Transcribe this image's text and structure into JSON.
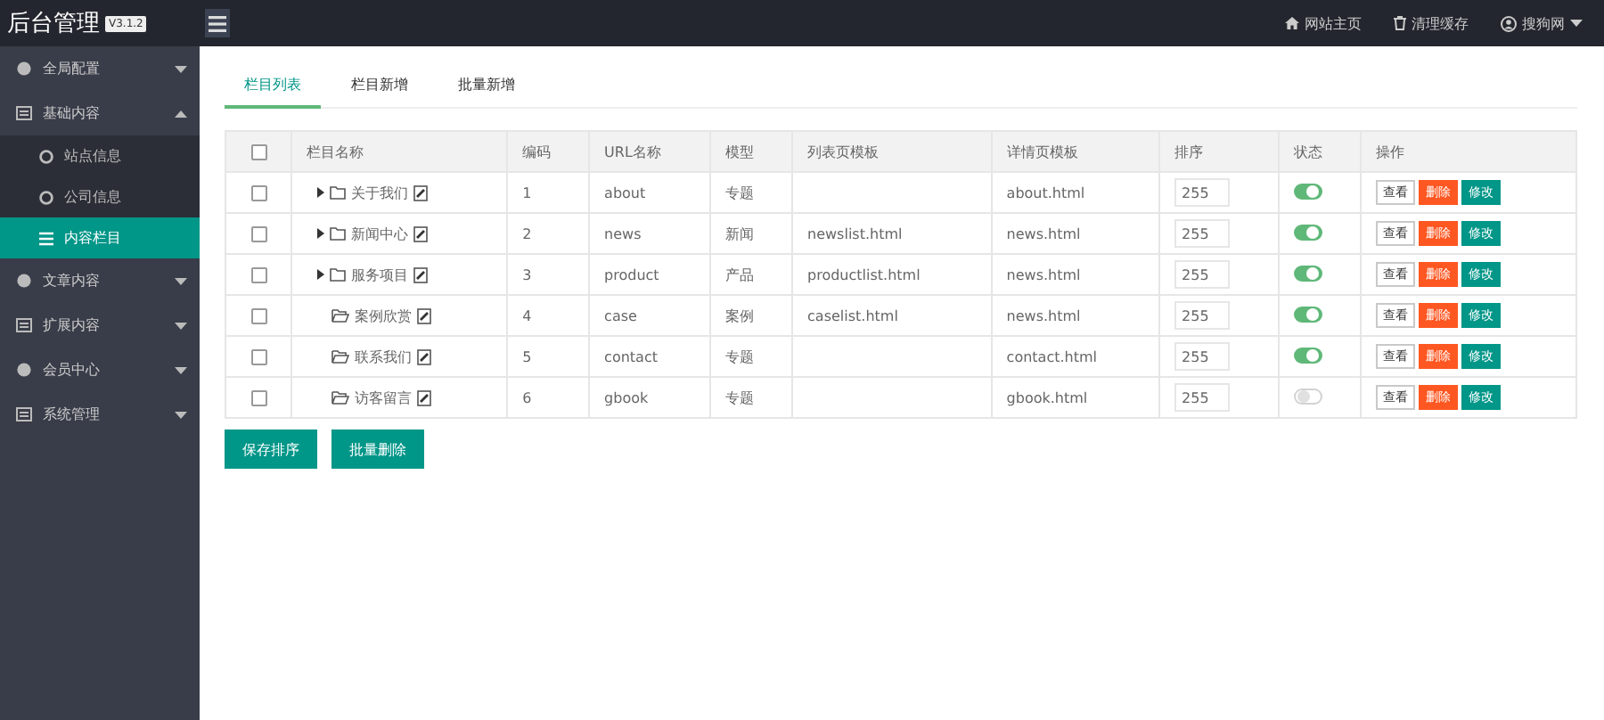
{
  "brand": {
    "title": "后台管理",
    "version": "V3.1.2"
  },
  "topbar": {
    "links": [
      {
        "label": "网站主页",
        "kind": "home"
      },
      {
        "label": "清理缓存",
        "kind": "trash"
      },
      {
        "label": "搜狗网",
        "kind": "user"
      }
    ]
  },
  "sidebar": {
    "items": [
      {
        "label": "全局配置",
        "expanded": false
      },
      {
        "label": "基础内容",
        "expanded": true,
        "children": [
          {
            "label": "站点信息",
            "selected": false
          },
          {
            "label": "公司信息",
            "selected": false
          },
          {
            "label": "内容栏目",
            "selected": true
          }
        ]
      },
      {
        "label": "文章内容",
        "expanded": false
      },
      {
        "label": "扩展内容",
        "expanded": false
      },
      {
        "label": "会员中心",
        "expanded": false
      },
      {
        "label": "系统管理",
        "expanded": false
      }
    ]
  },
  "tabs": [
    {
      "label": "栏目列表",
      "selected": true
    },
    {
      "label": "栏目新增",
      "selected": false
    },
    {
      "label": "批量新增",
      "selected": false
    }
  ],
  "table": {
    "select_all_checked": false,
    "columns": [
      "栏目名称",
      "编码",
      "URL名称",
      "模型",
      "列表页模板",
      "详情页模板",
      "排序",
      "状态",
      "操作"
    ],
    "rows": [
      {
        "checked": false,
        "has_children": true,
        "name": "关于我们",
        "code": "1",
        "url": "about",
        "model": "专题",
        "list_tpl": "",
        "detail_tpl": "about.html",
        "sort": "255",
        "on": true,
        "actions": [
          "查看",
          "删除",
          "修改"
        ]
      },
      {
        "checked": false,
        "has_children": true,
        "name": "新闻中心",
        "code": "2",
        "url": "news",
        "model": "新闻",
        "list_tpl": "newslist.html",
        "detail_tpl": "news.html",
        "sort": "255",
        "on": true,
        "actions": [
          "查看",
          "删除",
          "修改"
        ]
      },
      {
        "checked": false,
        "has_children": true,
        "name": "服务项目",
        "code": "3",
        "url": "product",
        "model": "产品",
        "list_tpl": "productlist.html",
        "detail_tpl": "news.html",
        "sort": "255",
        "on": true,
        "actions": [
          "查看",
          "删除",
          "修改"
        ]
      },
      {
        "checked": false,
        "has_children": false,
        "name": "案例欣赏",
        "code": "4",
        "url": "case",
        "model": "案例",
        "list_tpl": "caselist.html",
        "detail_tpl": "news.html",
        "sort": "255",
        "on": true,
        "actions": [
          "查看",
          "删除",
          "修改"
        ]
      },
      {
        "checked": false,
        "has_children": false,
        "name": "联系我们",
        "code": "5",
        "url": "contact",
        "model": "专题",
        "list_tpl": "",
        "detail_tpl": "contact.html",
        "sort": "255",
        "on": true,
        "actions": [
          "查看",
          "删除",
          "修改"
        ]
      },
      {
        "checked": false,
        "has_children": false,
        "name": "访客留言",
        "code": "6",
        "url": "gbook",
        "model": "专题",
        "list_tpl": "",
        "detail_tpl": "gbook.html",
        "sort": "255",
        "on": false,
        "actions": [
          "查看",
          "删除",
          "修改"
        ]
      }
    ]
  },
  "buttons": [
    "保存排序",
    "批量删除"
  ]
}
